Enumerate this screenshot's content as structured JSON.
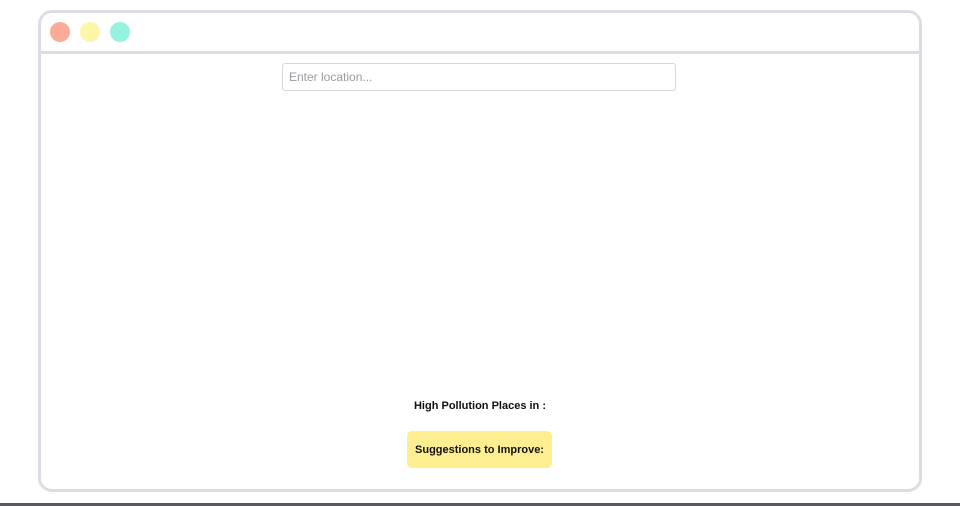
{
  "search": {
    "placeholder": "Enter location...",
    "value": ""
  },
  "main": {
    "heading": "High Pollution Places in :",
    "suggestions_label": "Suggestions to Improve:"
  },
  "colors": {
    "close_dot": "#fcac96",
    "minimize_dot": "#fdf6ab",
    "maximize_dot": "#95f2df",
    "button_bg": "#fdef8f",
    "border": "#dddde5"
  }
}
